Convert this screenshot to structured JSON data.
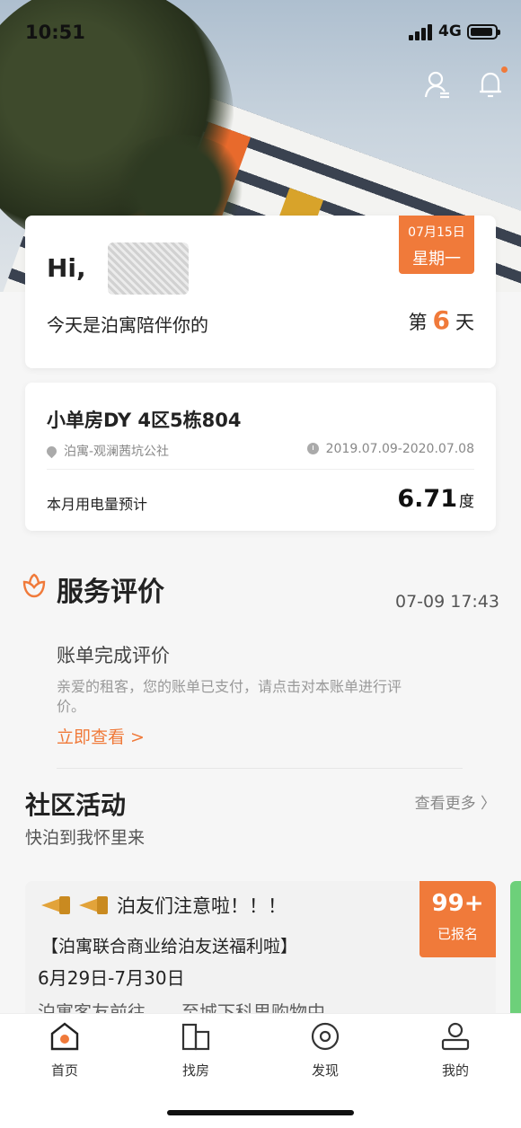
{
  "status_bar": {
    "time": "10:51",
    "network": "4G"
  },
  "greeting": {
    "hi": "Hi,",
    "date": "07月15日",
    "weekday": "星期一",
    "with_text": "今天是泊寓陪伴你的",
    "day_prefix": "第",
    "day_num": "6",
    "day_suffix": "天"
  },
  "room": {
    "title": "小单房DY 4区5栋804",
    "address": "泊寓-观澜茜坑公社",
    "period": "2019.07.09-2020.07.08",
    "electricity_label": "本月用电量预计",
    "electricity_value": "6.71",
    "electricity_unit": "度"
  },
  "service": {
    "title": "服务评价",
    "time": "07-09 17:43",
    "bill_title": "账单完成评价",
    "bill_desc": "亲爱的租客，您的账单已支付，请点击对本账单进行评价。",
    "link": "立即查看 >"
  },
  "community": {
    "title": "社区活动",
    "subtitle": "快泊到我怀里来",
    "more": "查看更多 〉",
    "activity": {
      "line1": "泊友们注意啦！！！",
      "line2": "【泊寓联合商业给泊友送福利啦】",
      "line3": "6月29日-7月30日",
      "line4": "泊寓客友前往……至城下科思购物中",
      "count": "99+",
      "count_label": "已报名"
    }
  },
  "nav": {
    "items": [
      {
        "label": "首页",
        "icon": "home-icon"
      },
      {
        "label": "找房",
        "icon": "building-icon"
      },
      {
        "label": "发现",
        "icon": "discover-icon"
      },
      {
        "label": "我的",
        "icon": "profile-icon"
      }
    ]
  },
  "colors": {
    "accent": "#f07a3a",
    "text": "#222222",
    "muted": "#888888"
  }
}
